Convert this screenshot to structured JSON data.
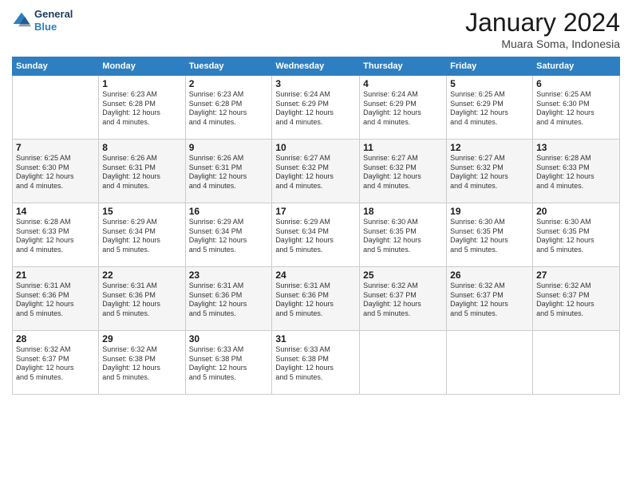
{
  "header": {
    "logo_line1": "General",
    "logo_line2": "Blue",
    "month_title": "January 2024",
    "location": "Muara Soma, Indonesia"
  },
  "days_of_week": [
    "Sunday",
    "Monday",
    "Tuesday",
    "Wednesday",
    "Thursday",
    "Friday",
    "Saturday"
  ],
  "weeks": [
    [
      {
        "day": "",
        "info": ""
      },
      {
        "day": "1",
        "info": "Sunrise: 6:23 AM\nSunset: 6:28 PM\nDaylight: 12 hours\nand 4 minutes."
      },
      {
        "day": "2",
        "info": "Sunrise: 6:23 AM\nSunset: 6:28 PM\nDaylight: 12 hours\nand 4 minutes."
      },
      {
        "day": "3",
        "info": "Sunrise: 6:24 AM\nSunset: 6:29 PM\nDaylight: 12 hours\nand 4 minutes."
      },
      {
        "day": "4",
        "info": "Sunrise: 6:24 AM\nSunset: 6:29 PM\nDaylight: 12 hours\nand 4 minutes."
      },
      {
        "day": "5",
        "info": "Sunrise: 6:25 AM\nSunset: 6:29 PM\nDaylight: 12 hours\nand 4 minutes."
      },
      {
        "day": "6",
        "info": "Sunrise: 6:25 AM\nSunset: 6:30 PM\nDaylight: 12 hours\nand 4 minutes."
      }
    ],
    [
      {
        "day": "7",
        "info": "Sunrise: 6:25 AM\nSunset: 6:30 PM\nDaylight: 12 hours\nand 4 minutes."
      },
      {
        "day": "8",
        "info": "Sunrise: 6:26 AM\nSunset: 6:31 PM\nDaylight: 12 hours\nand 4 minutes."
      },
      {
        "day": "9",
        "info": "Sunrise: 6:26 AM\nSunset: 6:31 PM\nDaylight: 12 hours\nand 4 minutes."
      },
      {
        "day": "10",
        "info": "Sunrise: 6:27 AM\nSunset: 6:32 PM\nDaylight: 12 hours\nand 4 minutes."
      },
      {
        "day": "11",
        "info": "Sunrise: 6:27 AM\nSunset: 6:32 PM\nDaylight: 12 hours\nand 4 minutes."
      },
      {
        "day": "12",
        "info": "Sunrise: 6:27 AM\nSunset: 6:32 PM\nDaylight: 12 hours\nand 4 minutes."
      },
      {
        "day": "13",
        "info": "Sunrise: 6:28 AM\nSunset: 6:33 PM\nDaylight: 12 hours\nand 4 minutes."
      }
    ],
    [
      {
        "day": "14",
        "info": "Sunrise: 6:28 AM\nSunset: 6:33 PM\nDaylight: 12 hours\nand 4 minutes."
      },
      {
        "day": "15",
        "info": "Sunrise: 6:29 AM\nSunset: 6:34 PM\nDaylight: 12 hours\nand 5 minutes."
      },
      {
        "day": "16",
        "info": "Sunrise: 6:29 AM\nSunset: 6:34 PM\nDaylight: 12 hours\nand 5 minutes."
      },
      {
        "day": "17",
        "info": "Sunrise: 6:29 AM\nSunset: 6:34 PM\nDaylight: 12 hours\nand 5 minutes."
      },
      {
        "day": "18",
        "info": "Sunrise: 6:30 AM\nSunset: 6:35 PM\nDaylight: 12 hours\nand 5 minutes."
      },
      {
        "day": "19",
        "info": "Sunrise: 6:30 AM\nSunset: 6:35 PM\nDaylight: 12 hours\nand 5 minutes."
      },
      {
        "day": "20",
        "info": "Sunrise: 6:30 AM\nSunset: 6:35 PM\nDaylight: 12 hours\nand 5 minutes."
      }
    ],
    [
      {
        "day": "21",
        "info": "Sunrise: 6:31 AM\nSunset: 6:36 PM\nDaylight: 12 hours\nand 5 minutes."
      },
      {
        "day": "22",
        "info": "Sunrise: 6:31 AM\nSunset: 6:36 PM\nDaylight: 12 hours\nand 5 minutes."
      },
      {
        "day": "23",
        "info": "Sunrise: 6:31 AM\nSunset: 6:36 PM\nDaylight: 12 hours\nand 5 minutes."
      },
      {
        "day": "24",
        "info": "Sunrise: 6:31 AM\nSunset: 6:36 PM\nDaylight: 12 hours\nand 5 minutes."
      },
      {
        "day": "25",
        "info": "Sunrise: 6:32 AM\nSunset: 6:37 PM\nDaylight: 12 hours\nand 5 minutes."
      },
      {
        "day": "26",
        "info": "Sunrise: 6:32 AM\nSunset: 6:37 PM\nDaylight: 12 hours\nand 5 minutes."
      },
      {
        "day": "27",
        "info": "Sunrise: 6:32 AM\nSunset: 6:37 PM\nDaylight: 12 hours\nand 5 minutes."
      }
    ],
    [
      {
        "day": "28",
        "info": "Sunrise: 6:32 AM\nSunset: 6:37 PM\nDaylight: 12 hours\nand 5 minutes."
      },
      {
        "day": "29",
        "info": "Sunrise: 6:32 AM\nSunset: 6:38 PM\nDaylight: 12 hours\nand 5 minutes."
      },
      {
        "day": "30",
        "info": "Sunrise: 6:33 AM\nSunset: 6:38 PM\nDaylight: 12 hours\nand 5 minutes."
      },
      {
        "day": "31",
        "info": "Sunrise: 6:33 AM\nSunset: 6:38 PM\nDaylight: 12 hours\nand 5 minutes."
      },
      {
        "day": "",
        "info": ""
      },
      {
        "day": "",
        "info": ""
      },
      {
        "day": "",
        "info": ""
      }
    ]
  ]
}
